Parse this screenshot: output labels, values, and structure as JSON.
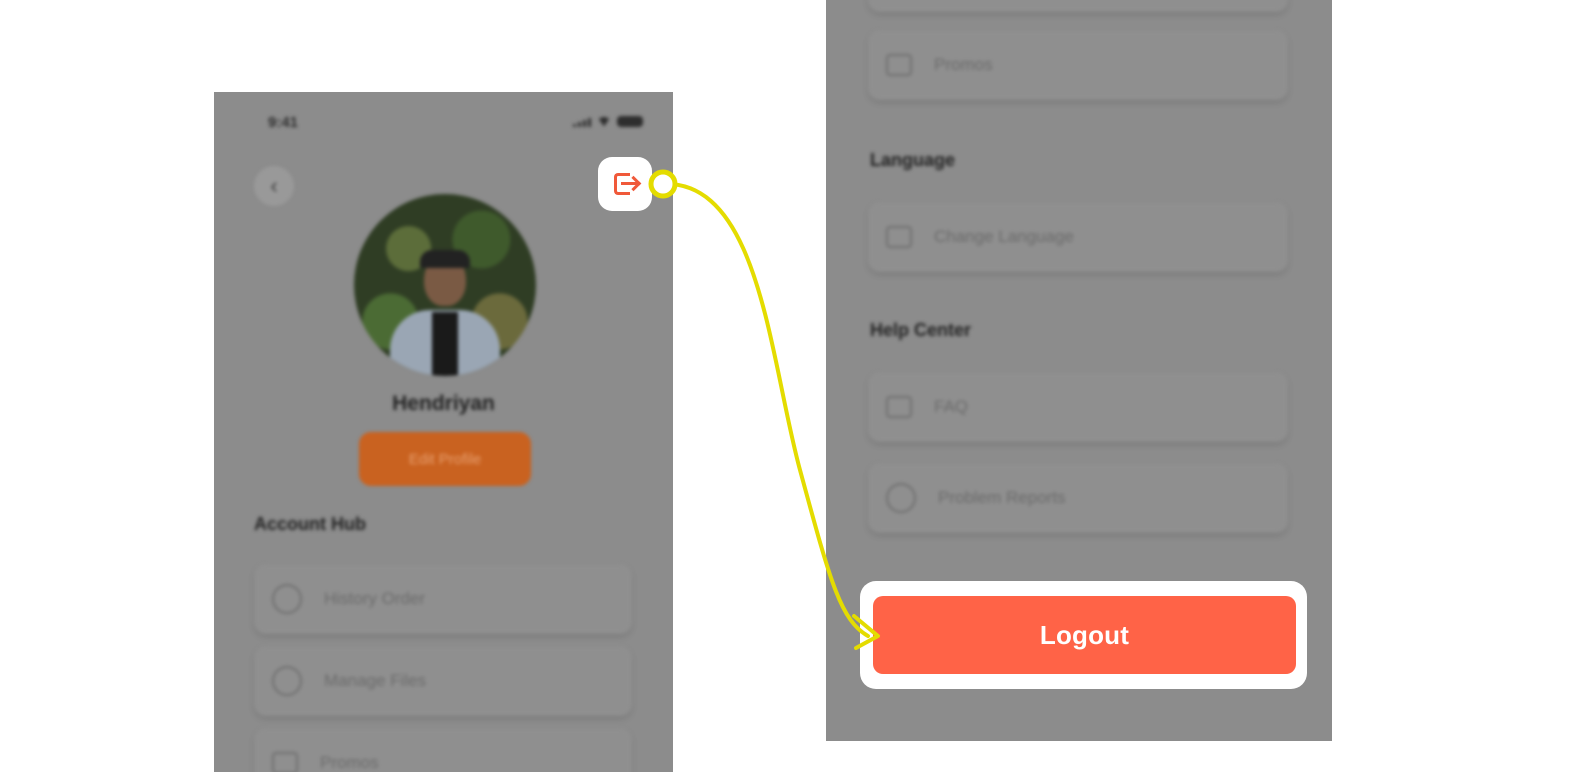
{
  "left_screen": {
    "status_time": "9:41",
    "back_icon": "chevron-left-icon",
    "user_name": "Hendriyan",
    "edit_profile_label": "Edit Profile",
    "account_section_title": "Account Hub",
    "account_items": [
      {
        "label": "History Order",
        "icon": "history-icon"
      },
      {
        "label": "Manage Files",
        "icon": "chat-icon"
      },
      {
        "label": "Promos",
        "icon": "promo-icon"
      }
    ],
    "logout_icon": "logout-icon"
  },
  "right_screen": {
    "top_item": {
      "label": "Promos",
      "icon": "promo-icon"
    },
    "language_section_title": "Language",
    "language_item": {
      "label": "Change Language",
      "icon": "translate-icon"
    },
    "help_section_title": "Help Center",
    "help_items": [
      {
        "label": "FAQ",
        "icon": "faq-icon"
      },
      {
        "label": "Problem Reports",
        "icon": "alert-icon"
      }
    ],
    "logout_label": "Logout"
  },
  "colors": {
    "accent": "#ff6347",
    "connector": "#e4dc00",
    "screen_overlay": "#8c8c8c",
    "edit_button": "#c96220"
  }
}
